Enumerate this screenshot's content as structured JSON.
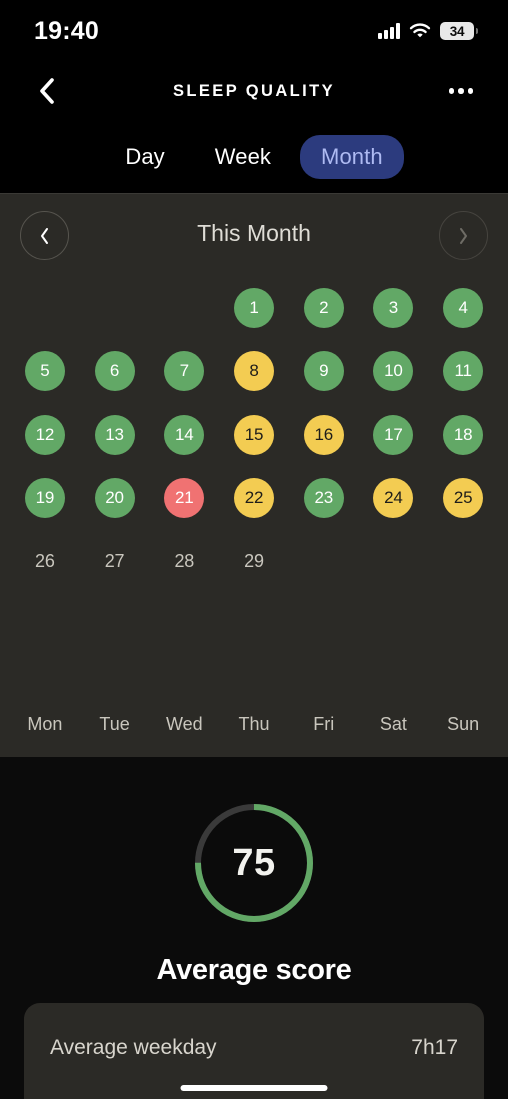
{
  "status_bar": {
    "time": "19:40",
    "cellular_icon": "cellular-signal-icon",
    "wifi_icon": "wifi-icon",
    "battery_level": "34"
  },
  "nav": {
    "back_icon": "chevron-left-icon",
    "title": "SLEEP QUALITY",
    "more_icon": "more-options-icon"
  },
  "segmented_control": {
    "options": [
      {
        "label": "Day",
        "active": false
      },
      {
        "label": "Week",
        "active": false
      },
      {
        "label": "Month",
        "active": true
      }
    ],
    "active_bg": "#2C3B7E",
    "active_text": "#AEBAF2"
  },
  "calendar": {
    "title": "This Month",
    "prev_icon": "chevron-left-icon",
    "next_icon": "chevron-right-icon",
    "next_disabled": true,
    "weekdays": [
      "Mon",
      "Tue",
      "Wed",
      "Thu",
      "Fri",
      "Sat",
      "Sun"
    ],
    "colors": {
      "good": "#62A866",
      "mid": "#F3CC52",
      "bad": "#F07272",
      "panel_bg": "#2B2A26"
    },
    "rows": [
      [
        {
          "label": "",
          "state": "empty"
        },
        {
          "label": "",
          "state": "empty"
        },
        {
          "label": "",
          "state": "empty"
        },
        {
          "label": "1",
          "state": "good"
        },
        {
          "label": "2",
          "state": "good"
        },
        {
          "label": "3",
          "state": "good"
        },
        {
          "label": "4",
          "state": "good"
        }
      ],
      [
        {
          "label": "5",
          "state": "good"
        },
        {
          "label": "6",
          "state": "good"
        },
        {
          "label": "7",
          "state": "good"
        },
        {
          "label": "8",
          "state": "mid"
        },
        {
          "label": "9",
          "state": "good"
        },
        {
          "label": "10",
          "state": "good"
        },
        {
          "label": "11",
          "state": "good"
        }
      ],
      [
        {
          "label": "12",
          "state": "good"
        },
        {
          "label": "13",
          "state": "good"
        },
        {
          "label": "14",
          "state": "good"
        },
        {
          "label": "15",
          "state": "mid"
        },
        {
          "label": "16",
          "state": "mid"
        },
        {
          "label": "17",
          "state": "good"
        },
        {
          "label": "18",
          "state": "good"
        }
      ],
      [
        {
          "label": "19",
          "state": "good"
        },
        {
          "label": "20",
          "state": "good"
        },
        {
          "label": "21",
          "state": "bad"
        },
        {
          "label": "22",
          "state": "mid"
        },
        {
          "label": "23",
          "state": "good"
        },
        {
          "label": "24",
          "state": "mid"
        },
        {
          "label": "25",
          "state": "mid"
        }
      ],
      [
        {
          "label": "26",
          "state": "plain"
        },
        {
          "label": "27",
          "state": "plain"
        },
        {
          "label": "28",
          "state": "plain"
        },
        {
          "label": "29",
          "state": "plain"
        },
        {
          "label": "",
          "state": "empty"
        },
        {
          "label": "",
          "state": "empty"
        },
        {
          "label": "",
          "state": "empty"
        }
      ]
    ]
  },
  "score": {
    "value": "75",
    "percent": 75,
    "label": "Average score",
    "ring_color": "#62A866",
    "track_color": "#3A3A3A"
  },
  "bottom_card": {
    "label": "Average weekday",
    "value": "7h17"
  }
}
